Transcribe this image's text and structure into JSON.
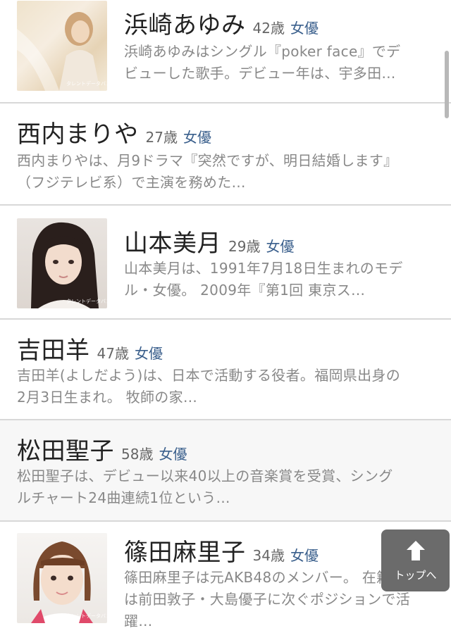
{
  "people": [
    {
      "name": "浜崎あゆみ",
      "age": "42歳",
      "job": "女優",
      "desc_line1": "浜崎あゆみはシングル『poker face』でデ",
      "desc_line2": "ビューした歌手。デビュー年は、宇多田…",
      "credit": "タレントデータバンク"
    },
    {
      "name": "西内まりや",
      "age": "27歳",
      "job": "女優",
      "desc_line1": "西内まりやは、月9ドラマ『突然ですが、明日結婚します』",
      "desc_line2": "（フジテレビ系）で主演を務めた…"
    },
    {
      "name": "山本美月",
      "age": "29歳",
      "job": "女優",
      "desc_line1": "山本美月は、1991年7月18日生まれのモデ",
      "desc_line2": "ル・女優。 2009年『第1回 東京ス…",
      "credit": "タレントデータバンク"
    },
    {
      "name": "吉田羊",
      "age": "47歳",
      "job": "女優",
      "desc_line1": "吉田羊(よしだよう)は、日本で活動する役者。福岡県出身の",
      "desc_line2": "2月3日生まれ。 牧師の家…"
    },
    {
      "name": "松田聖子",
      "age": "58歳",
      "job": "女優",
      "desc_line1": "松田聖子は、デビュー以来40以上の音楽賞を受賞、シング",
      "desc_line2": "ルチャート24曲連続1位という…"
    },
    {
      "name": "篠田麻里子",
      "age": "34歳",
      "job": "女優",
      "desc_line1": "篠田麻里子は元AKB48のメンバー。 在籍時",
      "desc_line2": "は前田敦子・大島優子に次ぐポジションで活",
      "desc_line3": "躍…",
      "credit": "タレントデータバンク"
    }
  ],
  "top_button": {
    "label": "トップへ",
    "icon": "arrow-up-icon"
  },
  "colors": {
    "job": "#3a5f8c",
    "divider": "#d8d8d8",
    "highlight": "#f7f7f7"
  }
}
